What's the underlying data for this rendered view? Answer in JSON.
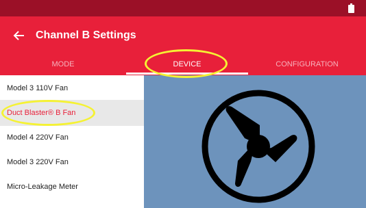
{
  "status_bar": {
    "color": "#9b1027",
    "icons": [
      "battery-icon"
    ]
  },
  "app_bar": {
    "color": "#e8203a",
    "back_icon": "arrow-left-icon",
    "title": "Channel B Settings"
  },
  "tabs": [
    {
      "label": "MODE",
      "active": false
    },
    {
      "label": "DEVICE",
      "active": true
    },
    {
      "label": "CONFIGURATION",
      "active": false
    }
  ],
  "device_list": {
    "items": [
      {
        "label": "Model 3 110V Fan",
        "selected": false
      },
      {
        "label": "Duct Blaster® B Fan",
        "selected": true
      },
      {
        "label": "Model 4 220V Fan",
        "selected": false
      },
      {
        "label": "Model 3 220V Fan",
        "selected": false
      },
      {
        "label": "Micro-Leakage Meter",
        "selected": false
      }
    ]
  },
  "preview": {
    "background": "#6d93bc",
    "icon": "fan-icon"
  },
  "annotations": {
    "highlight_color": "#f5f233"
  }
}
